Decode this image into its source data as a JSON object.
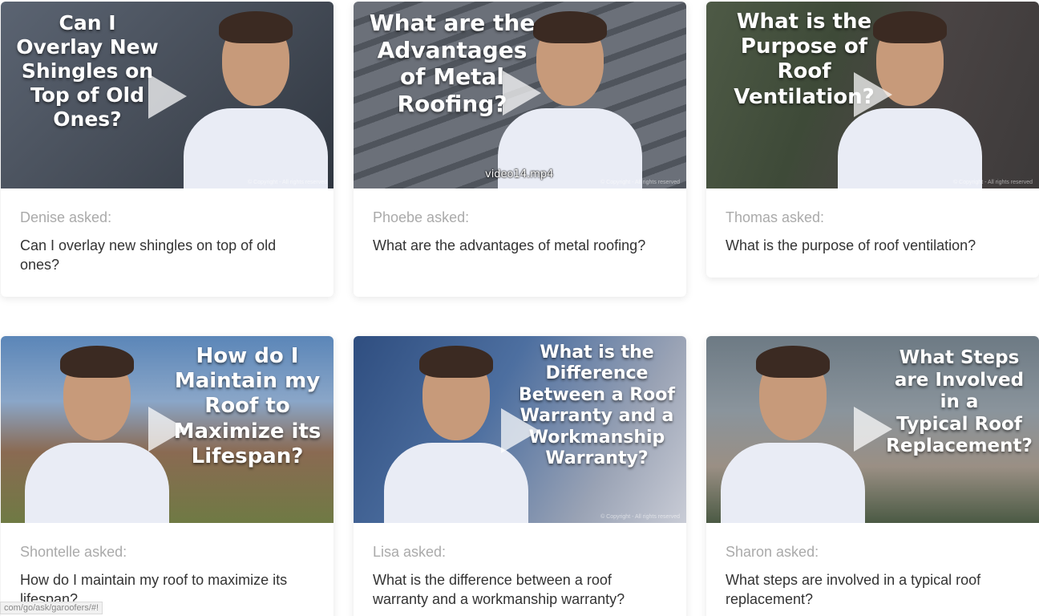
{
  "status_bar": {
    "url": "com/go/ask/garoofers/#!"
  },
  "videos": [
    {
      "asker": "Denise asked:",
      "question": "Can I overlay new shingles on top of old ones?",
      "thumb_title": "Can I\nOverlay New\nShingles on\nTop of Old\nOnes?",
      "file_label": "",
      "copyright": "© Copyright - All rights reserved",
      "colors": {
        "bg_from": "#5b6472",
        "bg_to": "#2f3640",
        "accent": "#8a6f5a"
      }
    },
    {
      "asker": "Phoebe asked:",
      "question": "What are the advantages of metal roofing?",
      "thumb_title": "What are the\nAdvantages\nof Metal\nRoofing?",
      "file_label": "video14.mp4",
      "copyright": "© Copyright - All rights reserved",
      "colors": {
        "bg_from": "#6b7079",
        "bg_to": "#3a3e45",
        "accent": "#4f545c"
      }
    },
    {
      "asker": "Thomas asked:",
      "question": "What is the purpose of roof ventilation?",
      "thumb_title": "What is the\nPurpose of\nRoof\nVentilation?",
      "file_label": "",
      "copyright": "© Copyright - All rights reserved",
      "colors": {
        "bg_from": "#4e5a46",
        "bg_to": "#3d3a3a",
        "accent": "#5d4b44"
      }
    },
    {
      "asker": "Shontelle asked:",
      "question": "How do I maintain my roof to maximize its lifespan?",
      "thumb_title": "How do I\nMaintain my\nRoof to\nMaximize its\nLifespan?",
      "file_label": "",
      "copyright": "",
      "colors": {
        "bg_from": "#5b86b8",
        "bg_to": "#7a6a52",
        "accent": "#8a3b2e"
      }
    },
    {
      "asker": "Lisa asked:",
      "question": "What is the difference between a roof warranty and a workmanship warranty?",
      "thumb_title": "What is the\nDifference\nBetween a Roof\nWarranty and a\nWorkmanship\nWarranty?",
      "file_label": "",
      "copyright": "© Copyright - All rights reserved",
      "colors": {
        "bg_from": "#4d6fa0",
        "bg_to": "#9aa3b5",
        "accent": "#2f4e80"
      }
    },
    {
      "asker": "Sharon asked:",
      "question": "What steps are involved in a typical roof replacement?",
      "thumb_title": "What Steps\nare Involved\nin a\nTypical Roof\nReplacement?",
      "file_label": "",
      "copyright": "",
      "colors": {
        "bg_from": "#6d7a84",
        "bg_to": "#4b5a44",
        "accent": "#9a8f84"
      }
    }
  ]
}
